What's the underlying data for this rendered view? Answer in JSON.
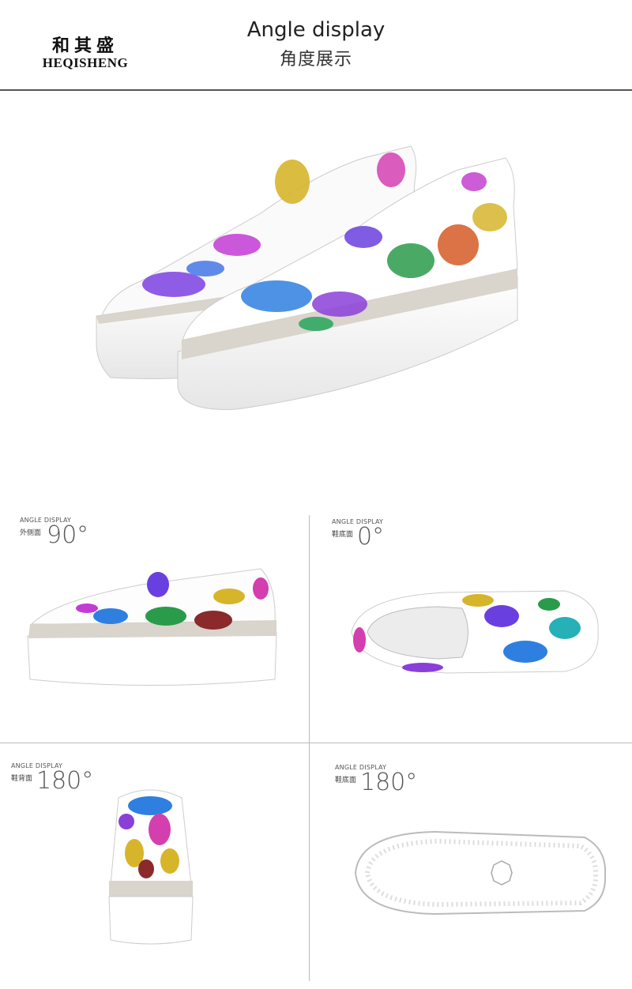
{
  "header": {
    "brand_cn": "和其盛",
    "brand_en": "HEQISHENG",
    "title_en": "Angle display",
    "title_cn": "角度展示"
  },
  "panels": [
    {
      "caption": "ANGLE DISPLAY",
      "sub": "外侧面",
      "angle": "90°"
    },
    {
      "caption": "ANGLE DISPLAY",
      "sub": "鞋底面",
      "angle": "0°"
    },
    {
      "caption": "ANGLE DISPLAY",
      "sub": "鞋背面",
      "angle": "180°"
    },
    {
      "caption": "ANGLE DISPLAY",
      "sub": "鞋底面",
      "angle": "180°"
    }
  ],
  "colors": {
    "rule": "#555555",
    "divider": "#bbbbbb",
    "sole": "#ffffff",
    "welt": "#d9d4cc"
  },
  "images": {
    "hero": "pair-of-slip-on-platform-sneakers",
    "side": "side-view-sneaker",
    "top": "top-view-sneaker",
    "back": "back-view-sneaker",
    "sole": "sole-view-sneaker"
  }
}
